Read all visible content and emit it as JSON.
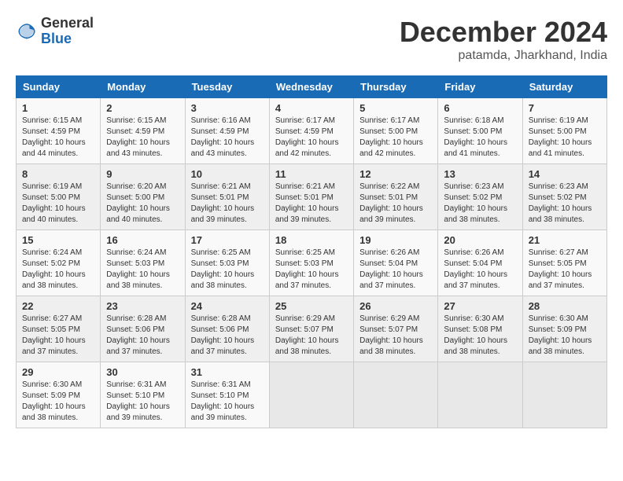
{
  "header": {
    "logo_general": "General",
    "logo_blue": "Blue",
    "month_title": "December 2024",
    "location": "patamda, Jharkhand, India"
  },
  "calendar": {
    "days_of_week": [
      "Sunday",
      "Monday",
      "Tuesday",
      "Wednesday",
      "Thursday",
      "Friday",
      "Saturday"
    ],
    "weeks": [
      [
        {
          "day": "",
          "info": ""
        },
        {
          "day": "2",
          "info": "Sunrise: 6:15 AM\nSunset: 4:59 PM\nDaylight: 10 hours\nand 43 minutes."
        },
        {
          "day": "3",
          "info": "Sunrise: 6:16 AM\nSunset: 4:59 PM\nDaylight: 10 hours\nand 43 minutes."
        },
        {
          "day": "4",
          "info": "Sunrise: 6:17 AM\nSunset: 4:59 PM\nDaylight: 10 hours\nand 42 minutes."
        },
        {
          "day": "5",
          "info": "Sunrise: 6:17 AM\nSunset: 5:00 PM\nDaylight: 10 hours\nand 42 minutes."
        },
        {
          "day": "6",
          "info": "Sunrise: 6:18 AM\nSunset: 5:00 PM\nDaylight: 10 hours\nand 41 minutes."
        },
        {
          "day": "7",
          "info": "Sunrise: 6:19 AM\nSunset: 5:00 PM\nDaylight: 10 hours\nand 41 minutes."
        }
      ],
      [
        {
          "day": "1",
          "info": "Sunrise: 6:15 AM\nSunset: 4:59 PM\nDaylight: 10 hours\nand 44 minutes.",
          "first": true
        },
        {
          "day": "9",
          "info": "Sunrise: 6:20 AM\nSunset: 5:00 PM\nDaylight: 10 hours\nand 40 minutes."
        },
        {
          "day": "10",
          "info": "Sunrise: 6:21 AM\nSunset: 5:01 PM\nDaylight: 10 hours\nand 39 minutes."
        },
        {
          "day": "11",
          "info": "Sunrise: 6:21 AM\nSunset: 5:01 PM\nDaylight: 10 hours\nand 39 minutes."
        },
        {
          "day": "12",
          "info": "Sunrise: 6:22 AM\nSunset: 5:01 PM\nDaylight: 10 hours\nand 39 minutes."
        },
        {
          "day": "13",
          "info": "Sunrise: 6:23 AM\nSunset: 5:02 PM\nDaylight: 10 hours\nand 38 minutes."
        },
        {
          "day": "14",
          "info": "Sunrise: 6:23 AM\nSunset: 5:02 PM\nDaylight: 10 hours\nand 38 minutes."
        }
      ],
      [
        {
          "day": "8",
          "info": "Sunrise: 6:19 AM\nSunset: 5:00 PM\nDaylight: 10 hours\nand 40 minutes."
        },
        {
          "day": "16",
          "info": "Sunrise: 6:24 AM\nSunset: 5:03 PM\nDaylight: 10 hours\nand 38 minutes."
        },
        {
          "day": "17",
          "info": "Sunrise: 6:25 AM\nSunset: 5:03 PM\nDaylight: 10 hours\nand 38 minutes."
        },
        {
          "day": "18",
          "info": "Sunrise: 6:25 AM\nSunset: 5:03 PM\nDaylight: 10 hours\nand 37 minutes."
        },
        {
          "day": "19",
          "info": "Sunrise: 6:26 AM\nSunset: 5:04 PM\nDaylight: 10 hours\nand 37 minutes."
        },
        {
          "day": "20",
          "info": "Sunrise: 6:26 AM\nSunset: 5:04 PM\nDaylight: 10 hours\nand 37 minutes."
        },
        {
          "day": "21",
          "info": "Sunrise: 6:27 AM\nSunset: 5:05 PM\nDaylight: 10 hours\nand 37 minutes."
        }
      ],
      [
        {
          "day": "15",
          "info": "Sunrise: 6:24 AM\nSunset: 5:02 PM\nDaylight: 10 hours\nand 38 minutes."
        },
        {
          "day": "23",
          "info": "Sunrise: 6:28 AM\nSunset: 5:06 PM\nDaylight: 10 hours\nand 37 minutes."
        },
        {
          "day": "24",
          "info": "Sunrise: 6:28 AM\nSunset: 5:06 PM\nDaylight: 10 hours\nand 37 minutes."
        },
        {
          "day": "25",
          "info": "Sunrise: 6:29 AM\nSunset: 5:07 PM\nDaylight: 10 hours\nand 38 minutes."
        },
        {
          "day": "26",
          "info": "Sunrise: 6:29 AM\nSunset: 5:07 PM\nDaylight: 10 hours\nand 38 minutes."
        },
        {
          "day": "27",
          "info": "Sunrise: 6:30 AM\nSunset: 5:08 PM\nDaylight: 10 hours\nand 38 minutes."
        },
        {
          "day": "28",
          "info": "Sunrise: 6:30 AM\nSunset: 5:09 PM\nDaylight: 10 hours\nand 38 minutes."
        }
      ],
      [
        {
          "day": "22",
          "info": "Sunrise: 6:27 AM\nSunset: 5:05 PM\nDaylight: 10 hours\nand 37 minutes."
        },
        {
          "day": "30",
          "info": "Sunrise: 6:31 AM\nSunset: 5:10 PM\nDaylight: 10 hours\nand 39 minutes."
        },
        {
          "day": "31",
          "info": "Sunrise: 6:31 AM\nSunset: 5:10 PM\nDaylight: 10 hours\nand 39 minutes."
        },
        {
          "day": "",
          "info": ""
        },
        {
          "day": "",
          "info": ""
        },
        {
          "day": "",
          "info": ""
        },
        {
          "day": "",
          "info": ""
        }
      ],
      [
        {
          "day": "29",
          "info": "Sunrise: 6:30 AM\nSunset: 5:09 PM\nDaylight: 10 hours\nand 38 minutes."
        },
        {
          "day": "",
          "info": ""
        },
        {
          "day": "",
          "info": ""
        },
        {
          "day": "",
          "info": ""
        },
        {
          "day": "",
          "info": ""
        },
        {
          "day": "",
          "info": ""
        },
        {
          "day": "",
          "info": ""
        }
      ]
    ]
  }
}
